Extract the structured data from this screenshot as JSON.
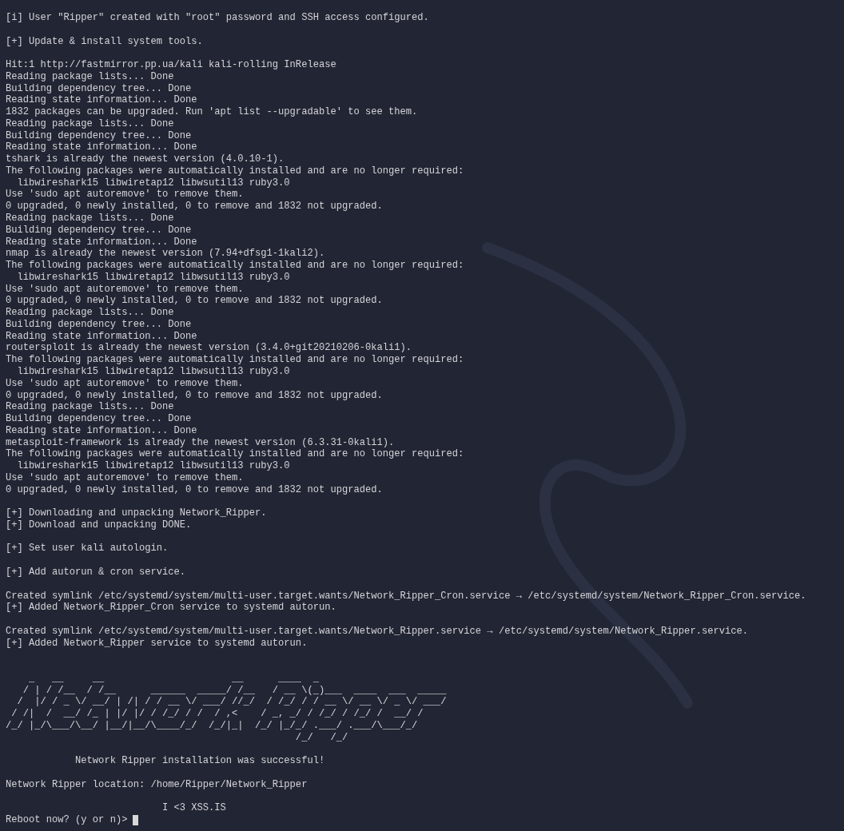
{
  "terminal": {
    "lines": [
      {
        "kind": "text",
        "text": "[i] User \"Ripper\" created with \"root\" password and SSH access configured."
      },
      {
        "kind": "blank"
      },
      {
        "kind": "text",
        "text": "[+] Update & install system tools."
      },
      {
        "kind": "blank"
      },
      {
        "kind": "text",
        "text": "Hit:1 http://fastmirror.pp.ua/kali kali-rolling InRelease"
      },
      {
        "kind": "text",
        "text": "Reading package lists... Done"
      },
      {
        "kind": "text",
        "text": "Building dependency tree... Done"
      },
      {
        "kind": "text",
        "text": "Reading state information... Done"
      },
      {
        "kind": "text",
        "text": "1832 packages can be upgraded. Run 'apt list --upgradable' to see them."
      },
      {
        "kind": "text",
        "text": "Reading package lists... Done"
      },
      {
        "kind": "text",
        "text": "Building dependency tree... Done"
      },
      {
        "kind": "text",
        "text": "Reading state information... Done"
      },
      {
        "kind": "text",
        "text": "tshark is already the newest version (4.0.10-1)."
      },
      {
        "kind": "text",
        "text": "The following packages were automatically installed and are no longer required:"
      },
      {
        "kind": "text",
        "text": "  libwireshark15 libwiretap12 libwsutil13 ruby3.0"
      },
      {
        "kind": "text",
        "text": "Use 'sudo apt autoremove' to remove them."
      },
      {
        "kind": "text",
        "text": "0 upgraded, 0 newly installed, 0 to remove and 1832 not upgraded."
      },
      {
        "kind": "text",
        "text": "Reading package lists... Done"
      },
      {
        "kind": "text",
        "text": "Building dependency tree... Done"
      },
      {
        "kind": "text",
        "text": "Reading state information... Done"
      },
      {
        "kind": "text",
        "text": "nmap is already the newest version (7.94+dfsg1-1kali2)."
      },
      {
        "kind": "text",
        "text": "The following packages were automatically installed and are no longer required:"
      },
      {
        "kind": "text",
        "text": "  libwireshark15 libwiretap12 libwsutil13 ruby3.0"
      },
      {
        "kind": "text",
        "text": "Use 'sudo apt autoremove' to remove them."
      },
      {
        "kind": "text",
        "text": "0 upgraded, 0 newly installed, 0 to remove and 1832 not upgraded."
      },
      {
        "kind": "text",
        "text": "Reading package lists... Done"
      },
      {
        "kind": "text",
        "text": "Building dependency tree... Done"
      },
      {
        "kind": "text",
        "text": "Reading state information... Done"
      },
      {
        "kind": "text",
        "text": "routersploit is already the newest version (3.4.0+git20210206-0kali1)."
      },
      {
        "kind": "text",
        "text": "The following packages were automatically installed and are no longer required:"
      },
      {
        "kind": "text",
        "text": "  libwireshark15 libwiretap12 libwsutil13 ruby3.0"
      },
      {
        "kind": "text",
        "text": "Use 'sudo apt autoremove' to remove them."
      },
      {
        "kind": "text",
        "text": "0 upgraded, 0 newly installed, 0 to remove and 1832 not upgraded."
      },
      {
        "kind": "text",
        "text": "Reading package lists... Done"
      },
      {
        "kind": "text",
        "text": "Building dependency tree... Done"
      },
      {
        "kind": "text",
        "text": "Reading state information... Done"
      },
      {
        "kind": "text",
        "text": "metasploit-framework is already the newest version (6.3.31-0kali1)."
      },
      {
        "kind": "text",
        "text": "The following packages were automatically installed and are no longer required:"
      },
      {
        "kind": "text",
        "text": "  libwireshark15 libwiretap12 libwsutil13 ruby3.0"
      },
      {
        "kind": "text",
        "text": "Use 'sudo apt autoremove' to remove them."
      },
      {
        "kind": "text",
        "text": "0 upgraded, 0 newly installed, 0 to remove and 1832 not upgraded."
      },
      {
        "kind": "blank"
      },
      {
        "kind": "text",
        "text": "[+] Downloading and unpacking Network_Ripper."
      },
      {
        "kind": "text",
        "text": "[+] Download and unpacking DONE."
      },
      {
        "kind": "blank"
      },
      {
        "kind": "text",
        "text": "[+] Set user kali autologin."
      },
      {
        "kind": "blank"
      },
      {
        "kind": "text",
        "text": "[+] Add autorun & cron service."
      },
      {
        "kind": "blank"
      },
      {
        "kind": "text",
        "text": "Created symlink /etc/systemd/system/multi-user.target.wants/Network_Ripper_Cron.service → /etc/systemd/system/Network_Ripper_Cron.service."
      },
      {
        "kind": "text",
        "text": "[+] Added Network_Ripper_Cron service to systemd autorun."
      },
      {
        "kind": "blank"
      },
      {
        "kind": "text",
        "text": "Created symlink /etc/systemd/system/multi-user.target.wants/Network_Ripper.service → /etc/systemd/system/Network_Ripper.service."
      },
      {
        "kind": "text",
        "text": "[+] Added Network_Ripper service to systemd autorun."
      },
      {
        "kind": "blank"
      },
      {
        "kind": "blank"
      },
      {
        "kind": "art",
        "rows": [
          "    _   __     __                      __      ____  _",
          "   / | / /__  / /__      ______  _____/ /__   / __ \\(_)___  ____  ___  _____",
          "  /  |/ / _ \\/ __/ | /| / / __ \\/ ___/ //_/  / /_/ / / __ \\/ __ \\/ _ \\/ ___/",
          " / /|  /  __/ /_ | |/ |/ / /_/ / /  / ,<    / _, _/ / /_/ / /_/ /  __/ /",
          "/_/ |_/\\___/\\__/ |__/|__/\\____/_/  /_/|_|  /_/ |_/_/ .___/ .___/\\___/_/",
          "                                                  /_/   /_/"
        ]
      },
      {
        "kind": "blank"
      },
      {
        "kind": "text",
        "text": "            Network Ripper installation was successful!"
      },
      {
        "kind": "blank"
      },
      {
        "kind": "text",
        "text": "Network Ripper location: /home/Ripper/Network_Ripper"
      },
      {
        "kind": "blank"
      },
      {
        "kind": "text",
        "text": "                           I <3 XSS.IS"
      },
      {
        "kind": "prompt",
        "text": "Reboot now? (y or n)>"
      }
    ]
  }
}
